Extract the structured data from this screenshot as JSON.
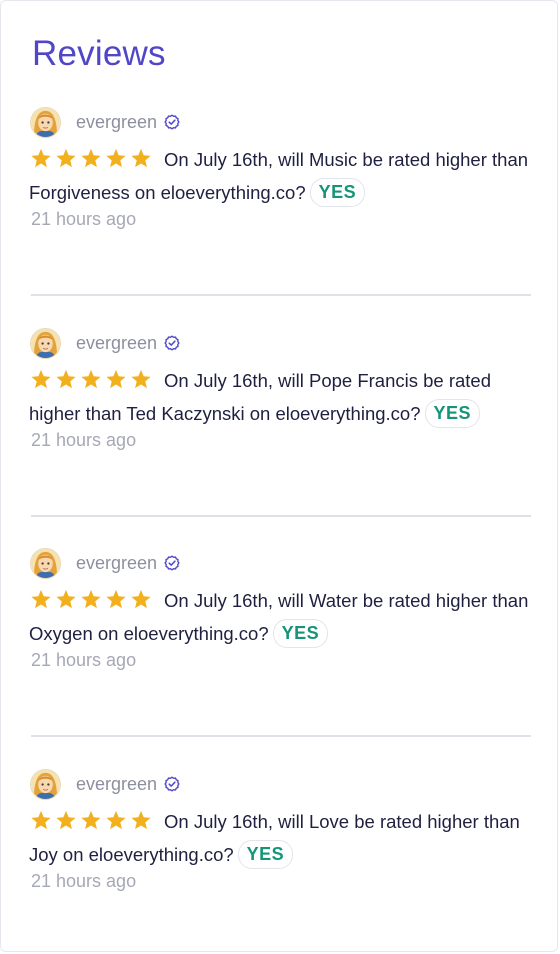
{
  "header": {
    "title": "Reviews"
  },
  "colors": {
    "title": "#4f46c8",
    "verified": "#4f46c8",
    "star": "#f2b01e",
    "answer": "#169478",
    "muted": "#a6a8b5"
  },
  "reviews": [
    {
      "username": "evergreen",
      "rating": 5,
      "text": "On July 16th, will Music be rated higher than Forgiveness on eloeverything.co?",
      "answer": "YES",
      "time": "21 hours ago"
    },
    {
      "username": "evergreen",
      "rating": 5,
      "text": "On July 16th, will Pope Francis be rated higher than Ted Kaczynski on eloeverything.co?",
      "answer": "YES",
      "time": "21 hours ago"
    },
    {
      "username": "evergreen",
      "rating": 5,
      "text": "On July 16th, will Water be rated higher than Oxygen on eloeverything.co?",
      "answer": "YES",
      "time": "21 hours ago"
    },
    {
      "username": "evergreen",
      "rating": 5,
      "text": "On July 16th, will Love be rated higher than Joy on eloeverything.co?",
      "answer": "YES",
      "time": "21 hours ago"
    }
  ]
}
